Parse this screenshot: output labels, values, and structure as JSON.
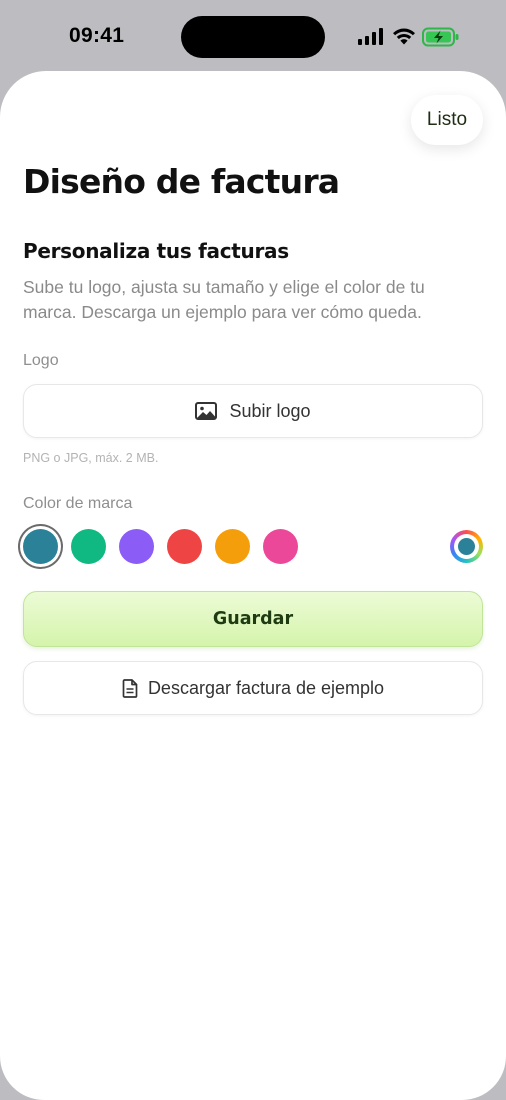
{
  "status_bar": {
    "time": "09:41",
    "icons": [
      "cellular-signal-icon",
      "wifi-icon",
      "battery-charging-icon"
    ]
  },
  "header": {
    "done_label": "Listo",
    "title": "Diseño de factura"
  },
  "intro": {
    "heading": "Personaliza tus facturas",
    "description": "Sube tu logo, ajusta su tamaño y elige el color de tu marca. Descarga un ejemplo para ver cómo queda."
  },
  "logo": {
    "label": "Logo",
    "upload_label": "Subir logo",
    "upload_icon": "image-icon",
    "hint": "PNG o JPG, máx. 2 MB."
  },
  "brand_color": {
    "label": "Color de marca",
    "swatches": [
      "#2a8198",
      "#10b981",
      "#8b5cf6",
      "#ef4444",
      "#f59e0b",
      "#ec4899"
    ],
    "selected_color": "#2a8198",
    "custom_picker_icon": "color-wheel-icon"
  },
  "actions": {
    "save_label": "Guardar",
    "download_label": "Descargar factura de ejemplo",
    "download_icon": "document-icon"
  }
}
